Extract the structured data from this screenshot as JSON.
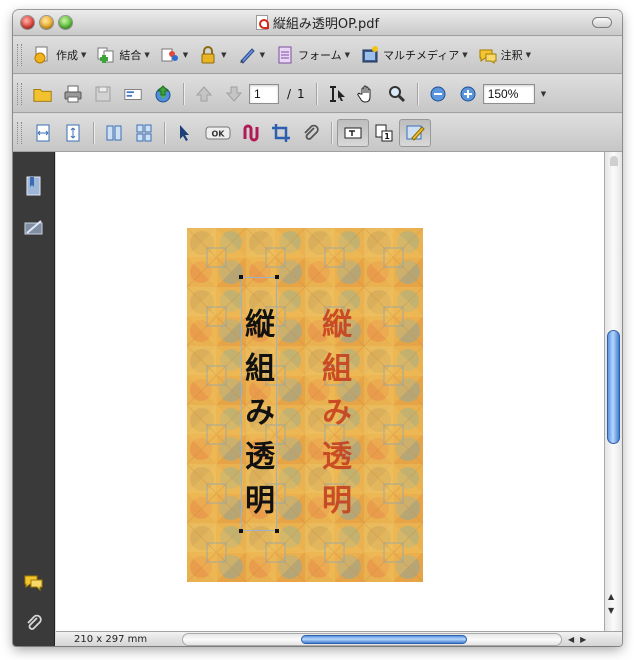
{
  "window": {
    "title": "縦組み透明OP.pdf"
  },
  "toolbar1": {
    "create_label": "作成",
    "combine_label": "結合",
    "forms_label": "フォーム",
    "multimedia_label": "マルチメディア",
    "comment_label": "注釈"
  },
  "toolbar2": {
    "page_number": "1",
    "page_separator": "/",
    "page_total": "1",
    "zoom": "150%"
  },
  "toolbar3": {
    "ok_label": "OK"
  },
  "document": {
    "vertical_text_black": "縦組み透明",
    "vertical_text_red": "縦組み透明"
  },
  "status": {
    "page_size": "210 x 297 mm"
  },
  "colors": {
    "accent_blue": "#3f7fd4",
    "text_red": "#c53a1c"
  }
}
